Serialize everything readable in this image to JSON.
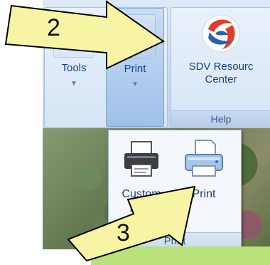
{
  "ribbon": {
    "tools_label": "Tools",
    "print_label": "Print",
    "resource_label_line1": "SDV Resourc",
    "resource_label_line2": "Center",
    "help_group_label": "Help"
  },
  "dropdown": {
    "custom_print_label": "Custom Print",
    "print_label": "Print",
    "group_label": "Print"
  },
  "annotations": {
    "step2": "2",
    "step3": "3"
  },
  "colors": {
    "arrow_fill": "#f7f5a3",
    "green_bar": "#b9e27c",
    "ribbon_text": "#15428b"
  }
}
